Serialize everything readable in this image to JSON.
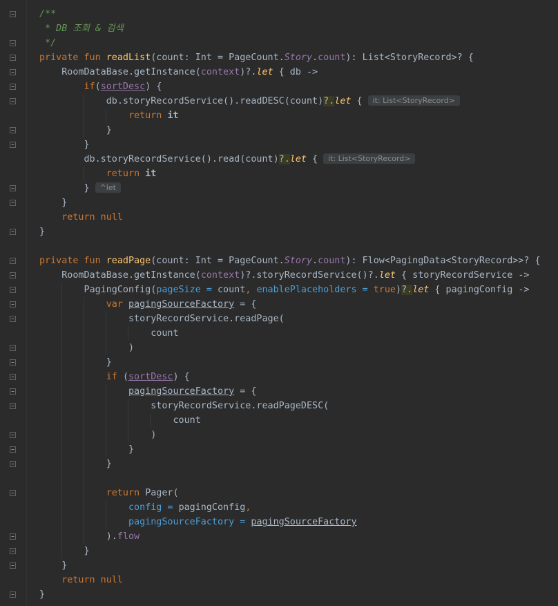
{
  "lines": [
    [
      {
        "t": "/**",
        "c": "cm"
      }
    ],
    [
      {
        "t": " * DB 조회 & 검색",
        "c": "cm"
      }
    ],
    [
      {
        "t": " */",
        "c": "cm"
      }
    ],
    [
      {
        "t": "private fun ",
        "c": "kw"
      },
      {
        "t": "readList",
        "c": "fn"
      },
      {
        "t": "(count: Int = PageCount."
      },
      {
        "t": "Story",
        "c": "prI"
      },
      {
        "t": "."
      },
      {
        "t": "count",
        "c": "pr"
      },
      {
        "t": "): List<StoryRecord>? {"
      }
    ],
    [
      {
        "t": "    RoomDataBase.getInstance("
      },
      {
        "t": "context",
        "c": "pr"
      },
      {
        "t": ")?."
      },
      {
        "t": "let",
        "c": "ext"
      },
      {
        "t": " { db ->"
      }
    ],
    [
      {
        "t": "        "
      },
      {
        "t": "if",
        "c": "kw"
      },
      {
        "t": "("
      },
      {
        "t": "sortDesc",
        "c": "pr ul"
      },
      {
        "t": ") {"
      }
    ],
    [
      {
        "t": "            db.storyRecordService().readDESC(count)"
      },
      {
        "t": "?.",
        "c": "hl"
      },
      {
        "t": "let",
        "c": "ext"
      },
      {
        "t": " {"
      },
      {
        "t": "it: List<StoryRecord>",
        "c": "hint"
      }
    ],
    [
      {
        "t": "                "
      },
      {
        "t": "return ",
        "c": "kw"
      },
      {
        "t": "it",
        "c": "b"
      }
    ],
    [
      {
        "t": "            }"
      }
    ],
    [
      {
        "t": "        }"
      }
    ],
    [
      {
        "t": "        db.storyRecordService().read(count)"
      },
      {
        "t": "?.",
        "c": "hl"
      },
      {
        "t": "let",
        "c": "ext"
      },
      {
        "t": " {"
      },
      {
        "t": "it: List<StoryRecord>",
        "c": "hint"
      }
    ],
    [
      {
        "t": "            "
      },
      {
        "t": "return ",
        "c": "kw"
      },
      {
        "t": "it",
        "c": "b"
      }
    ],
    [
      {
        "t": "        }"
      },
      {
        "t": "^let",
        "c": "hint"
      }
    ],
    [
      {
        "t": "    }"
      }
    ],
    [
      {
        "t": "    "
      },
      {
        "t": "return null",
        "c": "kw"
      }
    ],
    [
      {
        "t": "}"
      }
    ],
    [
      {
        "t": ""
      }
    ],
    [
      {
        "t": "private fun ",
        "c": "kw"
      },
      {
        "t": "readPage",
        "c": "fn"
      },
      {
        "t": "(count: Int = PageCount."
      },
      {
        "t": "Story",
        "c": "prI"
      },
      {
        "t": "."
      },
      {
        "t": "count",
        "c": "pr"
      },
      {
        "t": "): Flow<PagingData<StoryRecord>>? {"
      }
    ],
    [
      {
        "t": "    RoomDataBase.getInstance("
      },
      {
        "t": "context",
        "c": "pr"
      },
      {
        "t": ")?.storyRecordService()?."
      },
      {
        "t": "let",
        "c": "ext"
      },
      {
        "t": " { storyRecordService ->"
      }
    ],
    [
      {
        "t": "        PagingConfig("
      },
      {
        "t": "pageSize = ",
        "c": "pn"
      },
      {
        "t": "count"
      },
      {
        "t": ", ",
        "c": "kw"
      },
      {
        "t": "enablePlaceholders = ",
        "c": "pn"
      },
      {
        "t": "true",
        "c": "kw"
      },
      {
        "t": ")"
      },
      {
        "t": "?.",
        "c": "hl"
      },
      {
        "t": "let",
        "c": "ext"
      },
      {
        "t": " { pagingConfig ->"
      }
    ],
    [
      {
        "t": "            "
      },
      {
        "t": "var ",
        "c": "kw"
      },
      {
        "t": "pagingSourceFactory",
        "c": "ul"
      },
      {
        "t": " = {"
      }
    ],
    [
      {
        "t": "                storyRecordService.readPage("
      }
    ],
    [
      {
        "t": "                    count"
      }
    ],
    [
      {
        "t": "                )"
      }
    ],
    [
      {
        "t": "            }"
      }
    ],
    [
      {
        "t": "            "
      },
      {
        "t": "if ",
        "c": "kw"
      },
      {
        "t": "("
      },
      {
        "t": "sortDesc",
        "c": "pr ul"
      },
      {
        "t": ") {"
      }
    ],
    [
      {
        "t": "                "
      },
      {
        "t": "pagingSourceFactory",
        "c": "ul"
      },
      {
        "t": " = {"
      }
    ],
    [
      {
        "t": "                    storyRecordService.readPageDESC("
      }
    ],
    [
      {
        "t": "                        count"
      }
    ],
    [
      {
        "t": "                    )"
      }
    ],
    [
      {
        "t": "                }"
      }
    ],
    [
      {
        "t": "            }"
      }
    ],
    [
      {
        "t": ""
      }
    ],
    [
      {
        "t": "            "
      },
      {
        "t": "return ",
        "c": "kw"
      },
      {
        "t": "Pager("
      }
    ],
    [
      {
        "t": "                "
      },
      {
        "t": "config = ",
        "c": "pn"
      },
      {
        "t": "pagingConfig"
      },
      {
        "t": ",",
        "c": "kw"
      }
    ],
    [
      {
        "t": "                "
      },
      {
        "t": "pagingSourceFactory = ",
        "c": "pn"
      },
      {
        "t": "pagingSourceFactory",
        "c": "ul"
      }
    ],
    [
      {
        "t": "            )."
      },
      {
        "t": "flow",
        "c": "pr"
      }
    ],
    [
      {
        "t": "        }"
      }
    ],
    [
      {
        "t": "    }"
      }
    ],
    [
      {
        "t": "    "
      },
      {
        "t": "return null",
        "c": "kw"
      }
    ],
    [
      {
        "t": "}"
      }
    ]
  ]
}
